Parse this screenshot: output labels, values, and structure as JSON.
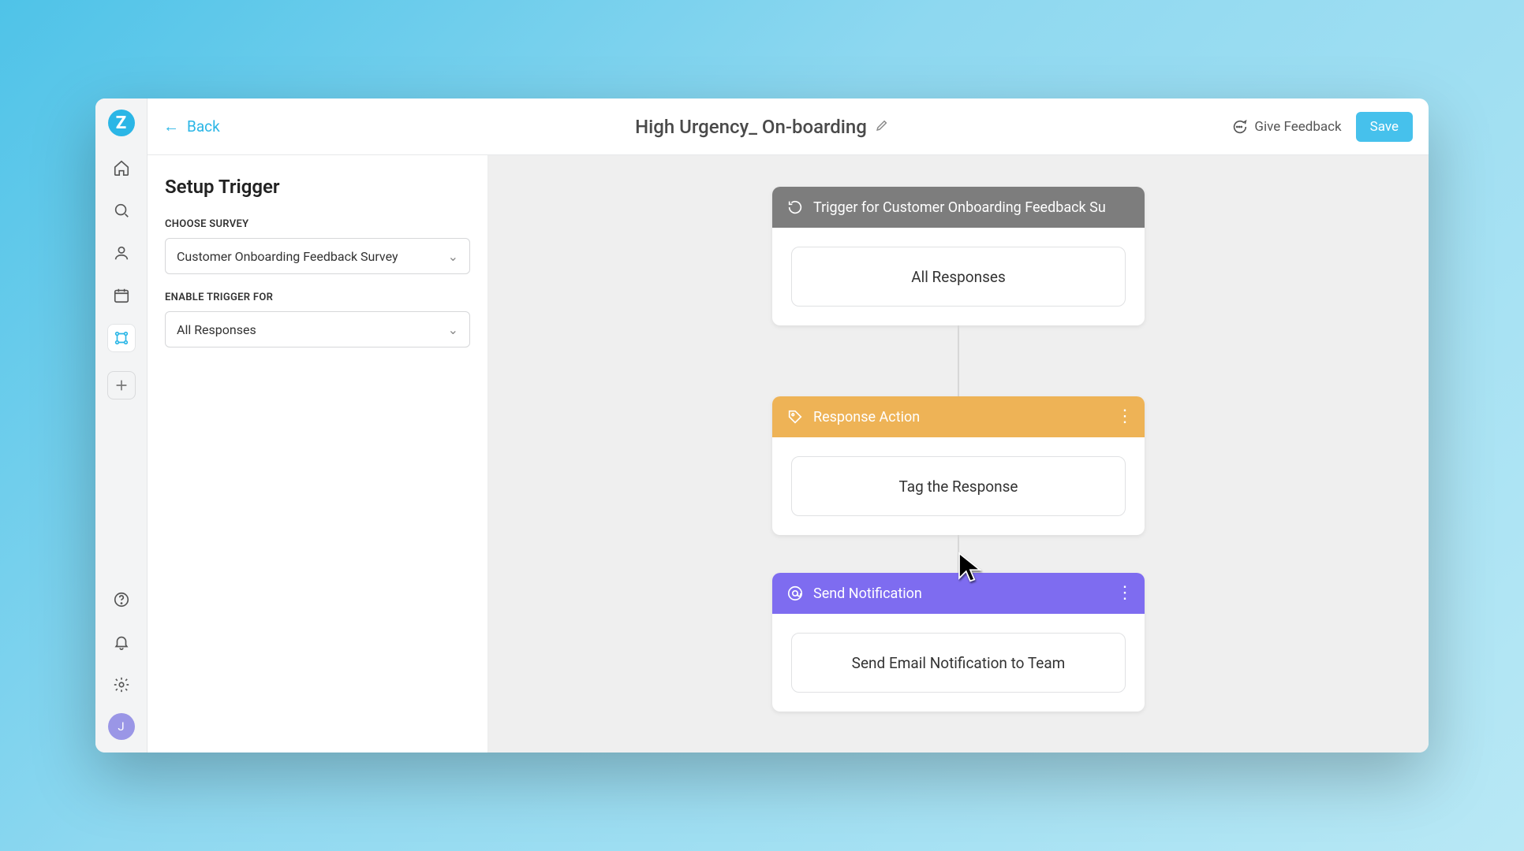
{
  "brand_letter": "Z",
  "topbar": {
    "back_label": "Back",
    "title": "High Urgency_ On-boarding",
    "give_feedback": "Give Feedback",
    "save": "Save"
  },
  "sidepanel": {
    "heading": "Setup Trigger",
    "choose_survey_label": "CHOOSE SURVEY",
    "choose_survey_value": "Customer Onboarding Feedback Survey",
    "enable_trigger_label": "ENABLE TRIGGER FOR",
    "enable_trigger_value": "All Responses"
  },
  "flow": {
    "trigger": {
      "header": "Trigger for Customer Onboarding Feedback Su",
      "body": "All Responses"
    },
    "action": {
      "header": "Response Action",
      "body": "Tag the Response"
    },
    "notification": {
      "header": "Send Notification",
      "body": "Send Email Notification to Team"
    }
  },
  "avatar_initial": "J",
  "colors": {
    "accent": "#2bb6e6",
    "node_gray": "#7d7d7d",
    "node_orange": "#eeb356",
    "node_purple": "#7e6cf0"
  }
}
